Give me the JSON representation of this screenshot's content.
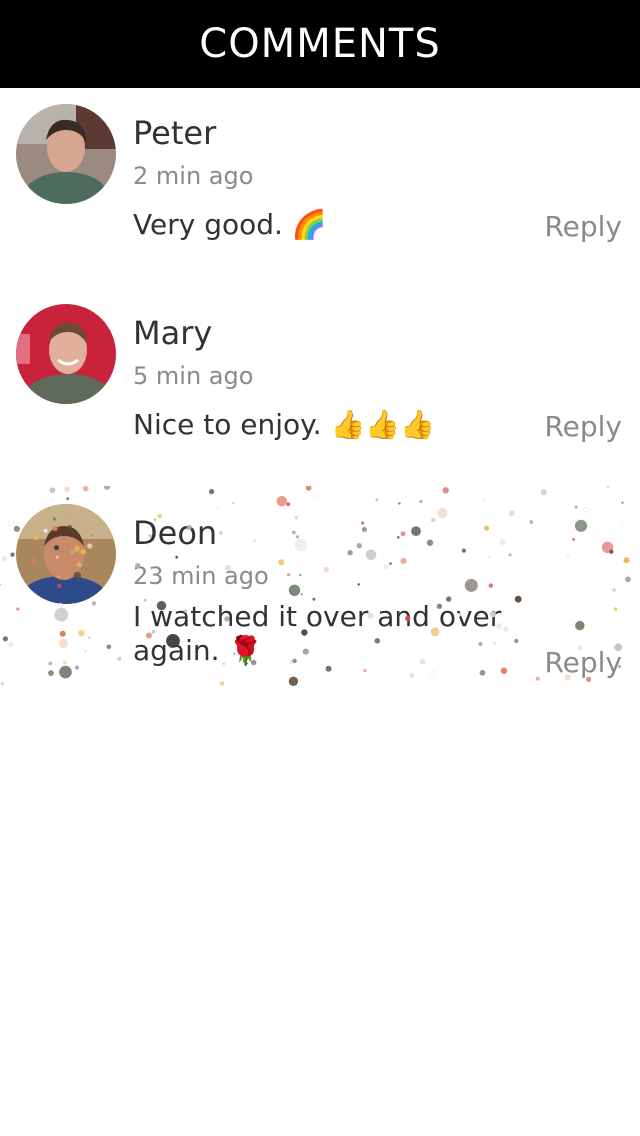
{
  "header": {
    "title": "COMMENTS"
  },
  "comments": [
    {
      "name": "Peter",
      "time": "2 min ago",
      "text": "Very good.",
      "emoji": "🌈",
      "reply": "Reply"
    },
    {
      "name": "Mary",
      "time": "5 min ago",
      "text": "Nice to enjoy.",
      "emoji": "👍👍👍",
      "reply": "Reply"
    },
    {
      "name": "Deon",
      "time": "23 min ago",
      "text": "I watched it over and over again.",
      "emoji": "🌹",
      "reply": "Reply"
    }
  ],
  "colors": {
    "header_bg": "#000000",
    "header_text": "#ffffff",
    "name_text": "#333333",
    "meta_text": "#8a8a8a"
  }
}
